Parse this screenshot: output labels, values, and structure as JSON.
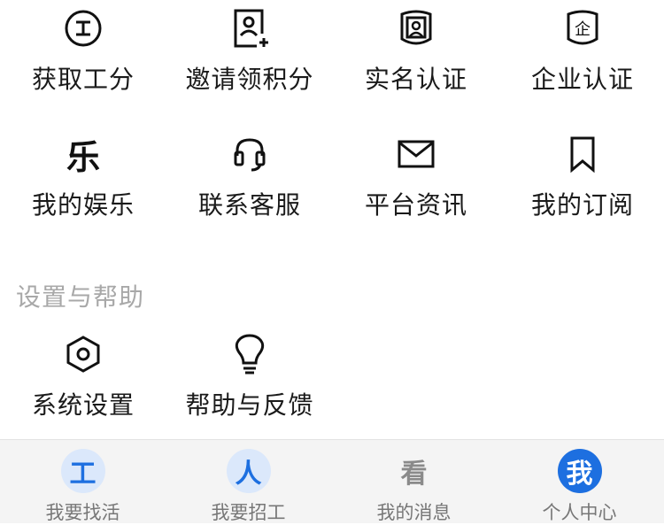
{
  "menu_rows": [
    [
      {
        "label": "获取工分",
        "icon": "circle-work-icon"
      },
      {
        "label": "邀请领积分",
        "icon": "invite-contact-icon"
      },
      {
        "label": "实名认证",
        "icon": "id-badge-icon"
      },
      {
        "label": "企业认证",
        "icon": "company-shield-icon"
      }
    ],
    [
      {
        "label": "我的娱乐",
        "icon": "entertainment-icon",
        "glyph": "乐"
      },
      {
        "label": "联系客服",
        "icon": "headset-icon"
      },
      {
        "label": "平台资讯",
        "icon": "mail-icon"
      },
      {
        "label": "我的订阅",
        "icon": "bookmark-icon"
      }
    ]
  ],
  "settings_section": {
    "title": "设置与帮助",
    "items": [
      {
        "label": "系统设置",
        "icon": "settings-hexagon-icon"
      },
      {
        "label": "帮助与反馈",
        "icon": "lightbulb-icon"
      }
    ]
  },
  "tabbar": {
    "tabs": [
      {
        "label": "我要找活",
        "glyph": "工",
        "icon": "find-work-icon",
        "color": "#1d6fe0",
        "bg": "#dbe8fb"
      },
      {
        "label": "我要招工",
        "glyph": "人",
        "icon": "recruit-icon",
        "color": "#1d6fe0",
        "bg": "#dbe8fb"
      },
      {
        "label": "我的消息",
        "glyph": "看",
        "icon": "messages-icon",
        "color": "#8a8a8a",
        "bg": "transparent"
      },
      {
        "label": "个人中心",
        "glyph": "我",
        "icon": "profile-icon",
        "color": "#ffffff",
        "bg": "#1d6fe0"
      }
    ]
  }
}
